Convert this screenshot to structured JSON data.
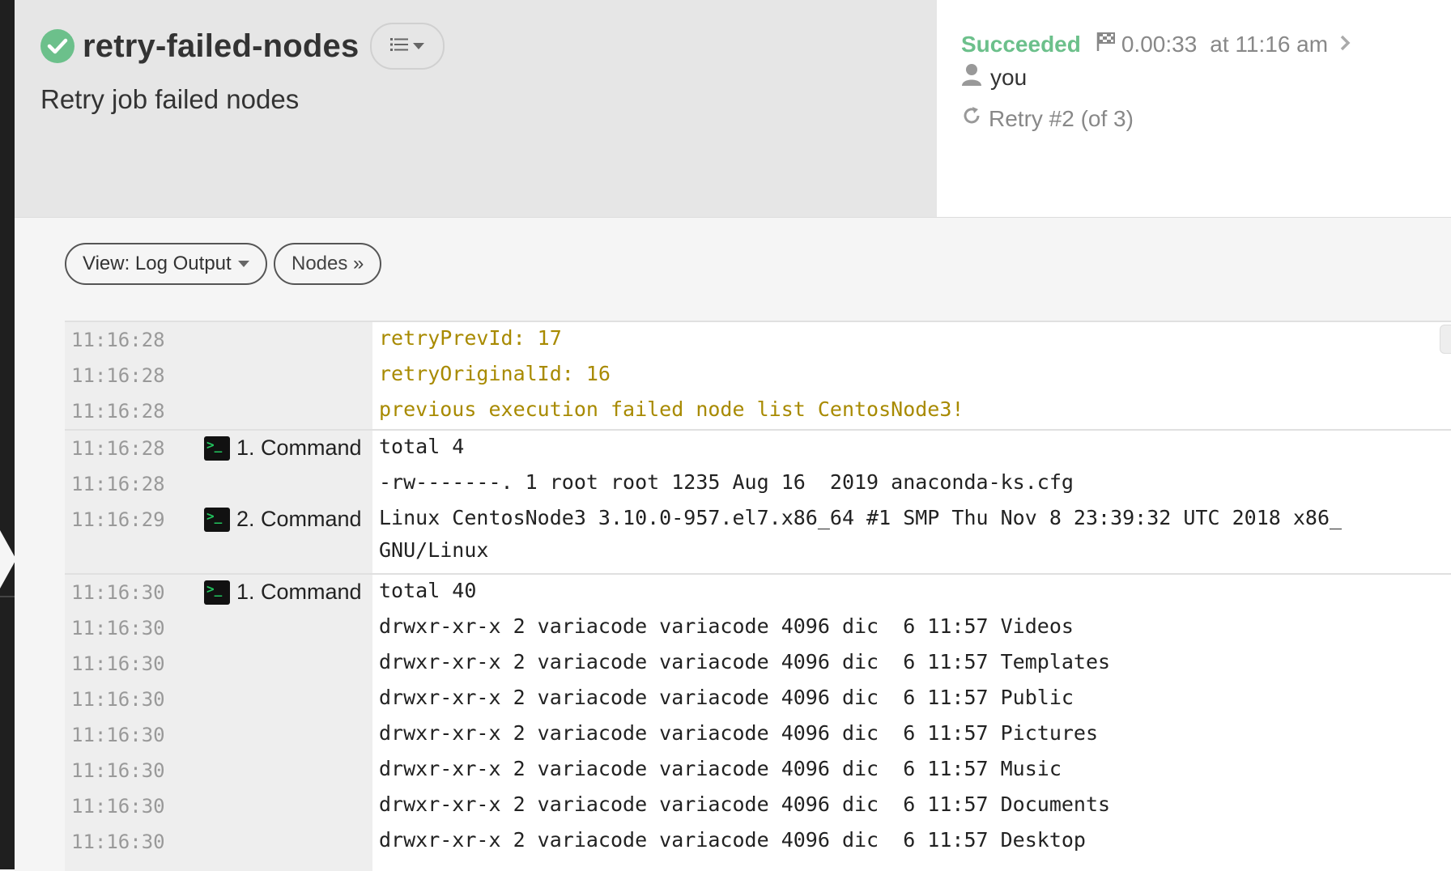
{
  "header": {
    "title": "retry-failed-nodes",
    "description": "Retry job failed nodes",
    "status": "Succeeded",
    "duration": "0.00:33",
    "time": "at 11:16 am",
    "user": "you",
    "retry": "Retry #2 (of 3)",
    "status_color": "#6cc08b"
  },
  "toolbar": {
    "view_label": "View: Log Output",
    "nodes_label": "Nodes »"
  },
  "log": {
    "rows": [
      {
        "time": "11:16:28",
        "step": "",
        "msg": "retryPrevId: 17",
        "warn": true
      },
      {
        "time": "11:16:28",
        "step": "",
        "msg": "retryOriginalId: 16",
        "warn": true
      },
      {
        "time": "11:16:28",
        "step": "",
        "msg": "previous execution failed node list CentosNode3!",
        "warn": true
      },
      {
        "time": "11:16:28",
        "step": "1. Command",
        "msg": "total 4"
      },
      {
        "time": "11:16:28",
        "step": "",
        "msg": "-rw-------. 1 root root 1235 Aug 16  2019 anaconda-ks.cfg"
      },
      {
        "time": "11:16:29",
        "step": "2. Command",
        "msg": "Linux CentosNode3 3.10.0-957.el7.x86_64 #1 SMP Thu Nov 8 23:39:32 UTC 2018 x86_",
        "msg2": "GNU/Linux"
      },
      {
        "time": "11:16:30",
        "step": "1. Command",
        "msg": "total 40"
      },
      {
        "time": "11:16:30",
        "step": "",
        "msg": "drwxr-xr-x 2 variacode variacode 4096 dic  6 11:57 Videos"
      },
      {
        "time": "11:16:30",
        "step": "",
        "msg": "drwxr-xr-x 2 variacode variacode 4096 dic  6 11:57 Templates"
      },
      {
        "time": "11:16:30",
        "step": "",
        "msg": "drwxr-xr-x 2 variacode variacode 4096 dic  6 11:57 Public"
      },
      {
        "time": "11:16:30",
        "step": "",
        "msg": "drwxr-xr-x 2 variacode variacode 4096 dic  6 11:57 Pictures"
      },
      {
        "time": "11:16:30",
        "step": "",
        "msg": "drwxr-xr-x 2 variacode variacode 4096 dic  6 11:57 Music"
      },
      {
        "time": "11:16:30",
        "step": "",
        "msg": "drwxr-xr-x 2 variacode variacode 4096 dic  6 11:57 Documents"
      },
      {
        "time": "11:16:30",
        "step": "",
        "msg": "drwxr-xr-x 2 variacode variacode 4096 dic  6 11:57 Desktop"
      }
    ]
  }
}
